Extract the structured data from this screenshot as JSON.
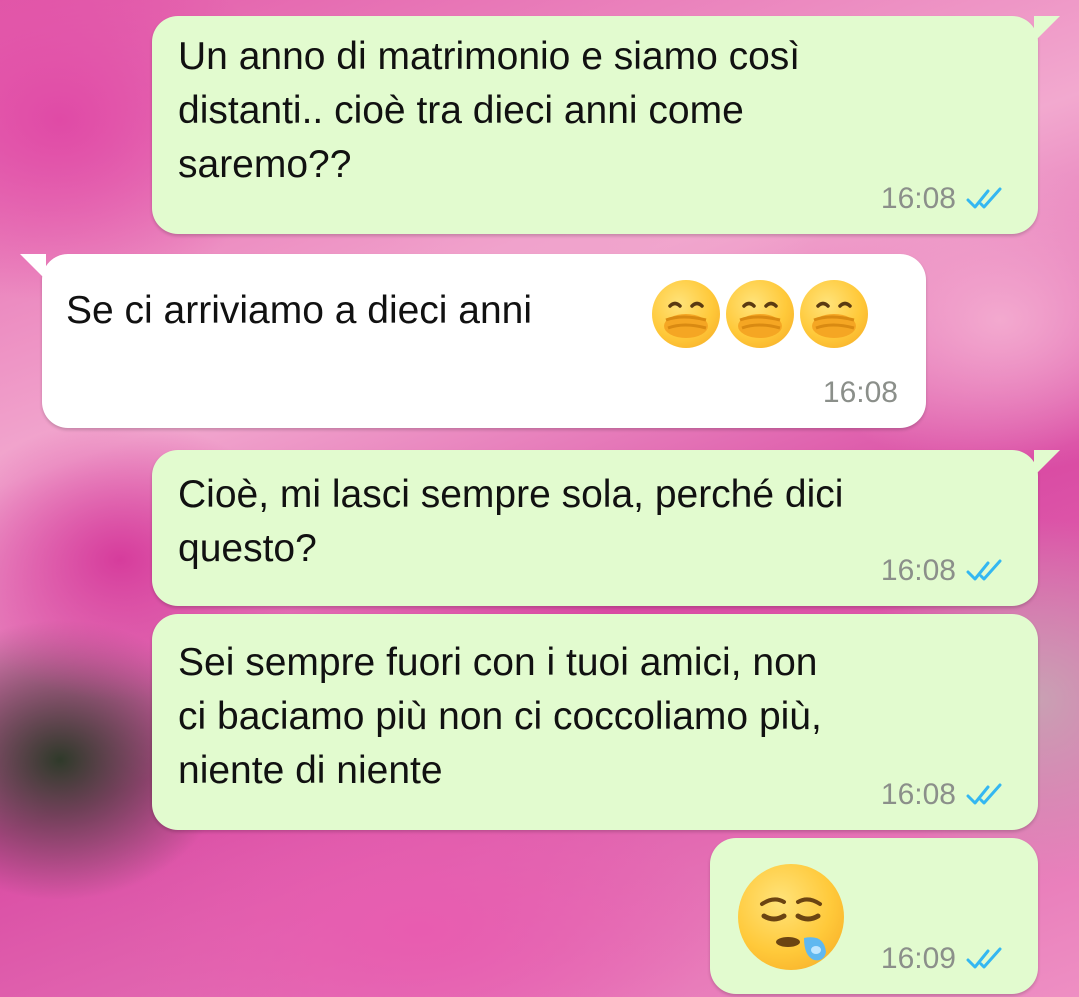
{
  "messages": [
    {
      "direction": "outgoing",
      "text": "Un anno di matrimonio e siamo così\ndistanti.. cioè tra dieci anni come\nsaremo??",
      "time": "16:08",
      "status_icon": "double-check-read-icon"
    },
    {
      "direction": "incoming",
      "text": "Se ci arriviamo a dieci anni",
      "emojis": [
        "hand-over-mouth-emoji",
        "hand-over-mouth-emoji",
        "hand-over-mouth-emoji"
      ],
      "time": "16:08"
    },
    {
      "direction": "outgoing",
      "text": "Cioè, mi lasci sempre sola, perché dici\nquesto?",
      "time": "16:08",
      "status_icon": "double-check-read-icon"
    },
    {
      "direction": "outgoing",
      "text": "Sei sempre fuori con i tuoi amici, non\nci baciamo più non ci coccoliamo più,\nniente di niente",
      "time": "16:08",
      "status_icon": "double-check-read-icon"
    },
    {
      "direction": "outgoing",
      "emojis": [
        "sleepy-face-emoji"
      ],
      "time": "16:09",
      "status_icon": "double-check-read-icon"
    }
  ],
  "colors": {
    "outgoing_bubble": "#e2fbcf",
    "incoming_bubble": "#ffffff",
    "timestamp": "#8b8f8a",
    "read_ticks": "#34b7f1"
  }
}
